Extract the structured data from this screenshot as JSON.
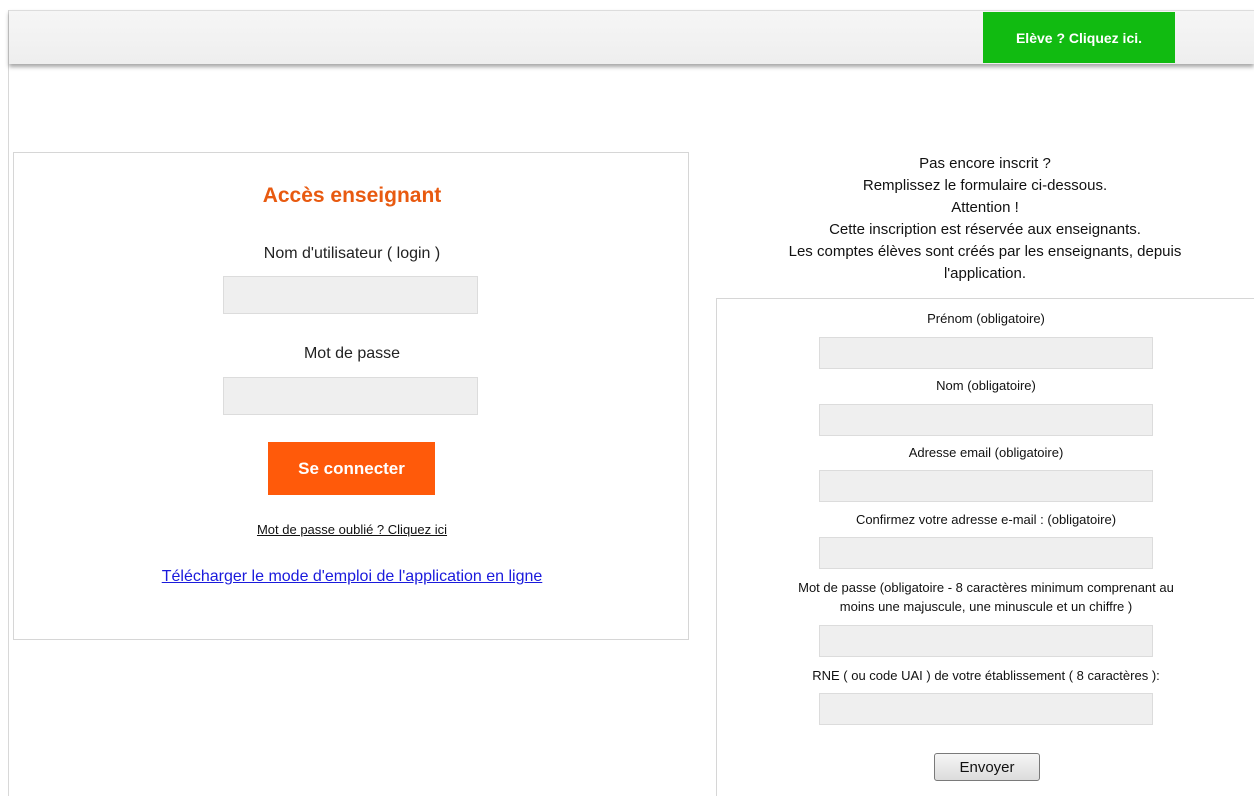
{
  "header": {
    "eleve_button_label": "Elève ? Cliquez ici.",
    "eleve_button_color": "#11bb11"
  },
  "login": {
    "title": "Accès enseignant",
    "username_label": "Nom d'utilisateur ( login )",
    "username_value": "",
    "password_label": "Mot de passe",
    "password_value": "",
    "submit_label": "Se connecter",
    "forgot_link": "Mot de passe oublié ? Cliquez ici",
    "manual_link": "Télécharger le mode d'emploi de l'application en ligne",
    "accent_color": "#ff5a0a"
  },
  "registration": {
    "intro_lines": [
      "Pas encore inscrit ?",
      "Remplissez le formulaire ci-dessous.",
      "Attention !",
      "Cette inscription est réservée aux enseignants.",
      "Les comptes élèves sont créés par les enseignants, depuis",
      "l'application."
    ],
    "fields": {
      "firstname_label": "Prénom (obligatoire)",
      "lastname_label": "Nom (obligatoire)",
      "email_label": "Adresse email (obligatoire)",
      "email_confirm_label": "Confirmez votre adresse e-mail : (obligatoire)",
      "password_label_line1": "Mot de passe (obligatoire - 8 caractères minimum comprenant au",
      "password_label_line2": "moins une majuscule, une minuscule et un chiffre )",
      "rne_label": "RNE ( ou code UAI ) de votre établissement ( 8 caractères ):"
    },
    "submit_label": "Envoyer"
  }
}
